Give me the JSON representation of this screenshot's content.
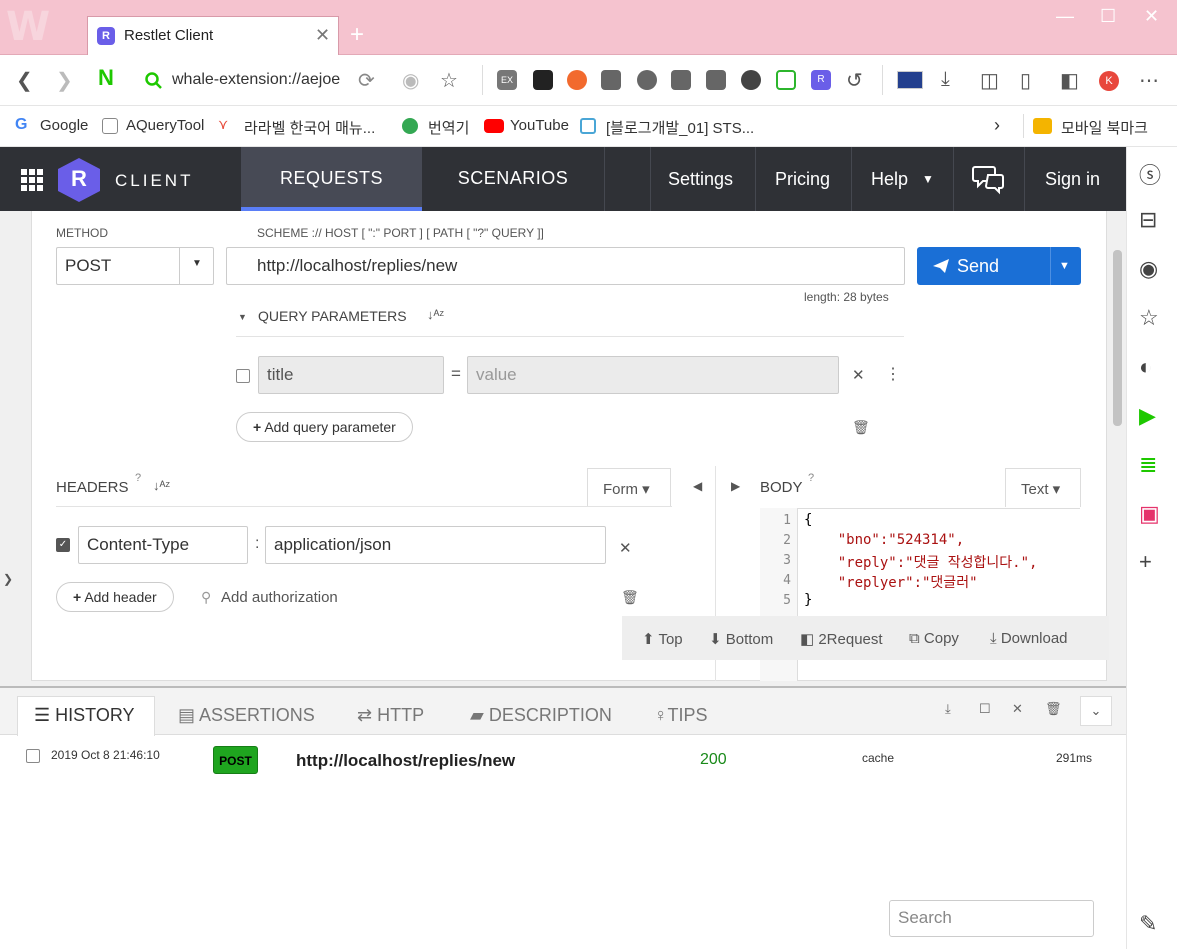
{
  "browser": {
    "tab_title": "Restlet Client",
    "tab_favicon_letter": "R",
    "url": "whale-extension://aejoe",
    "bookmarks": [
      "Google",
      "AQueryTool",
      "라라벨 한국어 매뉴...",
      "번역기",
      "YouTube",
      "[블로그개발_01] STS...",
      "모바일 북마크"
    ],
    "profile_letter": "K"
  },
  "app": {
    "logo_letter": "R",
    "brand": "CLIENT",
    "tabs": [
      "REQUESTS",
      "SCENARIOS"
    ],
    "nav": [
      "Settings",
      "Pricing",
      "Help",
      "Sign in"
    ]
  },
  "request": {
    "method_label": "METHOD",
    "method": "POST",
    "url_label": "SCHEME :// HOST [ \":\" PORT ] [ PATH [ \"?\" QUERY ]]",
    "url": "http://localhost/replies/new",
    "length": "length: 28 bytes",
    "send": "Send",
    "query_label": "QUERY PARAMETERS",
    "query_name_placeholder": "title",
    "query_value_placeholder": "value",
    "add_query": "Add query parameter",
    "headers_label": "HEADERS",
    "form_label": "Form",
    "header_name": "Content-Type",
    "header_value": "application/json",
    "add_header": "Add header",
    "add_auth": "Add authorization",
    "body_label": "BODY",
    "body_mode": "Text",
    "body_lines": [
      "{",
      "    \"bno\":\"524314\",",
      "    \"reply\":\"댓글 작성합니다.\",",
      "    \"replyer\":\"댓글러\"",
      "}"
    ],
    "line_numbers": [
      "1",
      "2",
      "3",
      "4",
      "5"
    ],
    "toolbar": [
      "Top",
      "Bottom",
      "2Request",
      "Copy",
      "Download"
    ]
  },
  "bottom": {
    "tabs": [
      "HISTORY",
      "ASSERTIONS",
      "HTTP",
      "DESCRIPTION",
      "TIPS"
    ],
    "history": [
      {
        "date": "2019 Oct 8 21:46:10",
        "method": "POST",
        "url": "http://localhost/replies/new",
        "status": "200",
        "cache": "cache",
        "time": "291ms"
      }
    ],
    "search_placeholder": "Search"
  },
  "colors": {
    "accent": "#1a6fd6",
    "header_bg": "#2f3136",
    "post_badge": "#1fa51f",
    "title_bar": "#f5c3cf"
  }
}
